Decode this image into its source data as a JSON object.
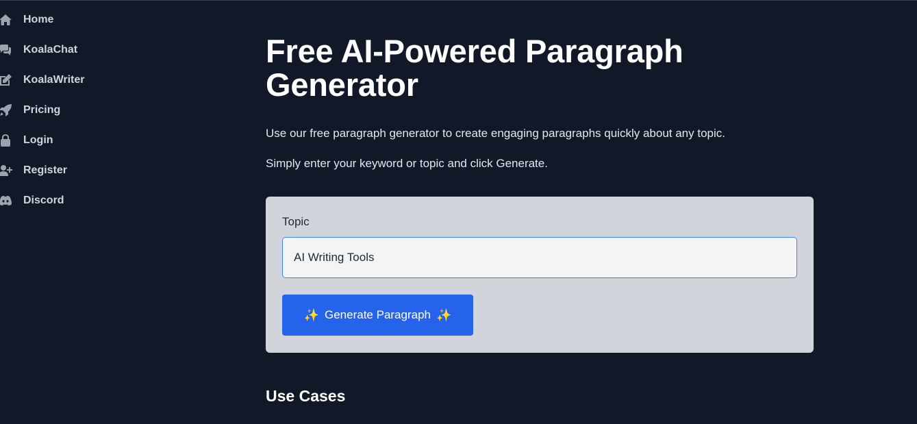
{
  "sidebar": {
    "items": [
      {
        "label": "Home",
        "icon": "home-icon"
      },
      {
        "label": "KoalaChat",
        "icon": "chat-icon"
      },
      {
        "label": "KoalaWriter",
        "icon": "edit-icon"
      },
      {
        "label": "Pricing",
        "icon": "rocket-icon"
      },
      {
        "label": "Login",
        "icon": "lock-icon"
      },
      {
        "label": "Register",
        "icon": "user-plus-icon"
      },
      {
        "label": "Discord",
        "icon": "discord-icon"
      }
    ]
  },
  "main": {
    "title": "Free AI-Powered Paragraph Generator",
    "description_1": "Use our free paragraph generator to create engaging paragraphs quickly about any topic.",
    "description_2": "Simply enter your keyword or topic and click Generate.",
    "form": {
      "topic_label": "Topic",
      "topic_value": "AI Writing Tools",
      "button_label": "Generate Paragraph",
      "button_icon": "sparkles-icon"
    },
    "use_cases_heading": "Use Cases"
  },
  "colors": {
    "background": "#111827",
    "card": "#d1d5db",
    "accent": "#2563eb"
  }
}
